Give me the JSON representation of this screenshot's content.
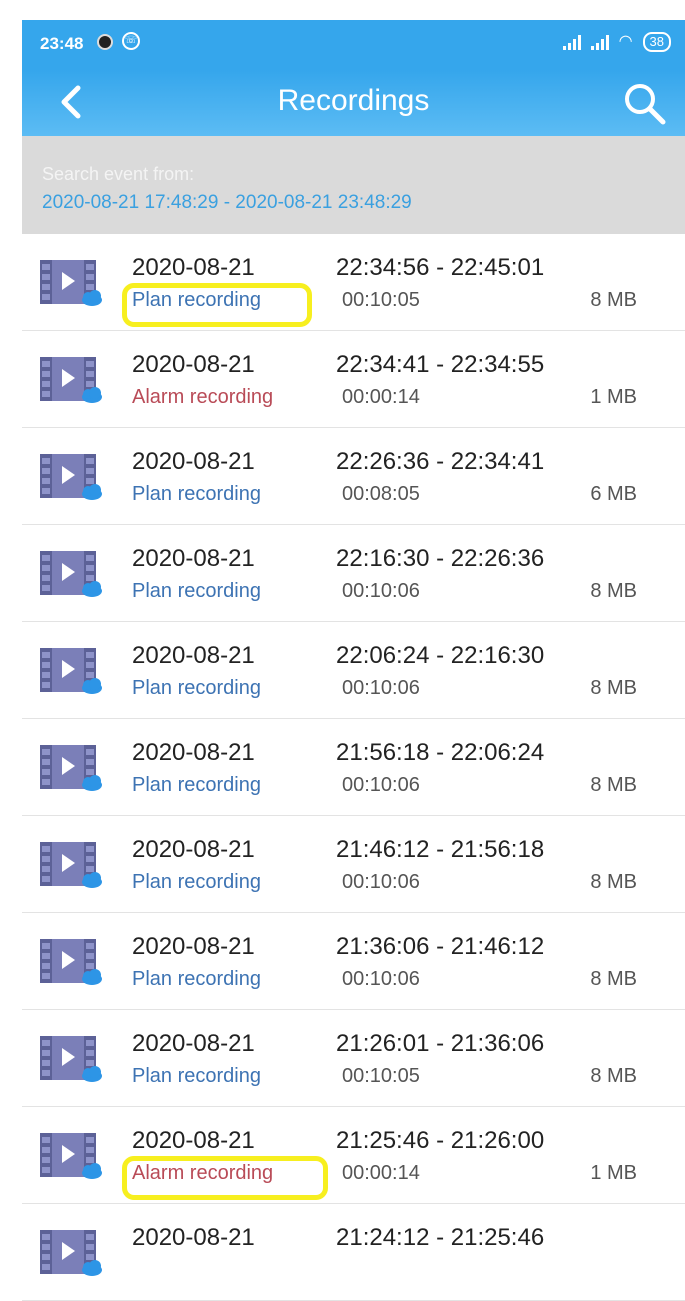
{
  "status": {
    "time": "23:48",
    "battery": "38"
  },
  "appbar": {
    "title": "Recordings"
  },
  "range": {
    "label": "Search event from:",
    "value": "2020-08-21 17:48:29 - 2020-08-21 23:48:29"
  },
  "colors": {
    "accent": "#35a6ec",
    "plan": "#3d73b3",
    "alarm": "#b94b57",
    "highlight": "#f7ef1f"
  },
  "recordings": [
    {
      "date": "2020-08-21",
      "type": "Plan recording",
      "kind": "plan",
      "range": "22:34:56 - 22:45:01",
      "duration": "00:10:05",
      "size": "8 MB",
      "highlighted": true
    },
    {
      "date": "2020-08-21",
      "type": "Alarm recording",
      "kind": "alarm",
      "range": "22:34:41 - 22:34:55",
      "duration": "00:00:14",
      "size": "1 MB",
      "highlighted": false
    },
    {
      "date": "2020-08-21",
      "type": "Plan recording",
      "kind": "plan",
      "range": "22:26:36 - 22:34:41",
      "duration": "00:08:05",
      "size": "6 MB",
      "highlighted": false
    },
    {
      "date": "2020-08-21",
      "type": "Plan recording",
      "kind": "plan",
      "range": "22:16:30 - 22:26:36",
      "duration": "00:10:06",
      "size": "8 MB",
      "highlighted": false
    },
    {
      "date": "2020-08-21",
      "type": "Plan recording",
      "kind": "plan",
      "range": "22:06:24 - 22:16:30",
      "duration": "00:10:06",
      "size": "8 MB",
      "highlighted": false
    },
    {
      "date": "2020-08-21",
      "type": "Plan recording",
      "kind": "plan",
      "range": "21:56:18 - 22:06:24",
      "duration": "00:10:06",
      "size": "8 MB",
      "highlighted": false
    },
    {
      "date": "2020-08-21",
      "type": "Plan recording",
      "kind": "plan",
      "range": "21:46:12 - 21:56:18",
      "duration": "00:10:06",
      "size": "8 MB",
      "highlighted": false
    },
    {
      "date": "2020-08-21",
      "type": "Plan recording",
      "kind": "plan",
      "range": "21:36:06 - 21:46:12",
      "duration": "00:10:06",
      "size": "8 MB",
      "highlighted": false
    },
    {
      "date": "2020-08-21",
      "type": "Plan recording",
      "kind": "plan",
      "range": "21:26:01 - 21:36:06",
      "duration": "00:10:05",
      "size": "8 MB",
      "highlighted": false
    },
    {
      "date": "2020-08-21",
      "type": "Alarm recording",
      "kind": "alarm",
      "range": "21:25:46 - 21:26:00",
      "duration": "00:00:14",
      "size": "1 MB",
      "highlighted": true
    },
    {
      "date": "2020-08-21",
      "type": "",
      "kind": "plan",
      "range": "21:24:12 - 21:25:46",
      "duration": "",
      "size": "",
      "highlighted": false
    }
  ]
}
